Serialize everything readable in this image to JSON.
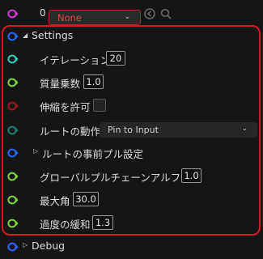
{
  "top": {
    "index": "0",
    "dropdown_value": "None"
  },
  "settings": {
    "title": "Settings"
  },
  "rows": {
    "iteration": {
      "label": "イテレーション",
      "value": "20"
    },
    "mass_mult": {
      "label": "質量乗数",
      "value": "1.0"
    },
    "allow_stretch": {
      "label": "伸縮を許可"
    },
    "root_action": {
      "label": "ルートの動作",
      "value": "Pin to Input"
    },
    "root_prepull": {
      "label": "ルートの事前プル設定"
    },
    "global_alpha": {
      "label": "グローバルプルチェーンアルファ",
      "value": "1.0"
    },
    "max_angle": {
      "label": "最大角",
      "value": "30.0"
    },
    "over_relax": {
      "label": "過度の緩和",
      "value": "1.3"
    }
  },
  "debug": {
    "title": "Debug"
  },
  "colors": {
    "accent_red": "#d71826",
    "pin_magenta": "#d63bd6",
    "pin_teal": "#2fd0b8",
    "pin_green": "#7bd636",
    "pin_red": "#a3121f",
    "pin_blue": "#2d66ff",
    "pin_dark_teal": "#1c7c72"
  },
  "icons": [
    "struct-pin-icon",
    "float-pin-icon",
    "bool-pin-icon",
    "enum-pin-icon",
    "chevron-down-icon",
    "triangle-right-icon",
    "circle-arrow-icon",
    "search-icon"
  ]
}
